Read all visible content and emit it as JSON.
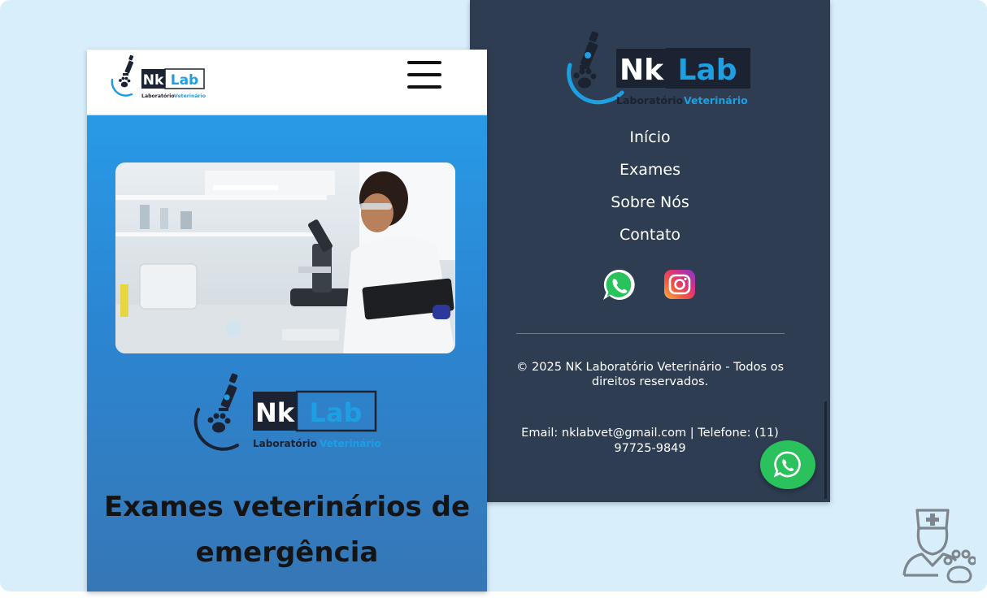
{
  "brand": {
    "name_part1": "Nk",
    "name_part2": "Lab",
    "tagline_part1": "Laboratório",
    "tagline_part2": "Veterinário",
    "colors": {
      "dark": "#1b2231",
      "blue": "#1d9fe2"
    }
  },
  "mobile": {
    "hero_title": "Exames veterinários de emergência",
    "hero_image": "scientist-microscope-photo",
    "menu_icon": "hamburger-menu-icon"
  },
  "footer": {
    "nav": [
      "Início",
      "Exames",
      "Sobre Nós",
      "Contato"
    ],
    "social": [
      "whatsapp-icon",
      "instagram-icon"
    ],
    "copyright": "© 2025 NK Laboratório Veterinário - Todos os direitos reservados.",
    "contact": "Email: nklabvet@gmail.com | Telefone: (11) 97725-9849",
    "floating_button": "whatsapp-float-icon"
  },
  "colors": {
    "backdrop": "#d8eefb",
    "footer_bg": "#2e3d51",
    "hero_gradient_top": "#28a0ee",
    "hero_gradient_bottom": "#3677b6",
    "whatsapp_green": "#29c25c"
  }
}
